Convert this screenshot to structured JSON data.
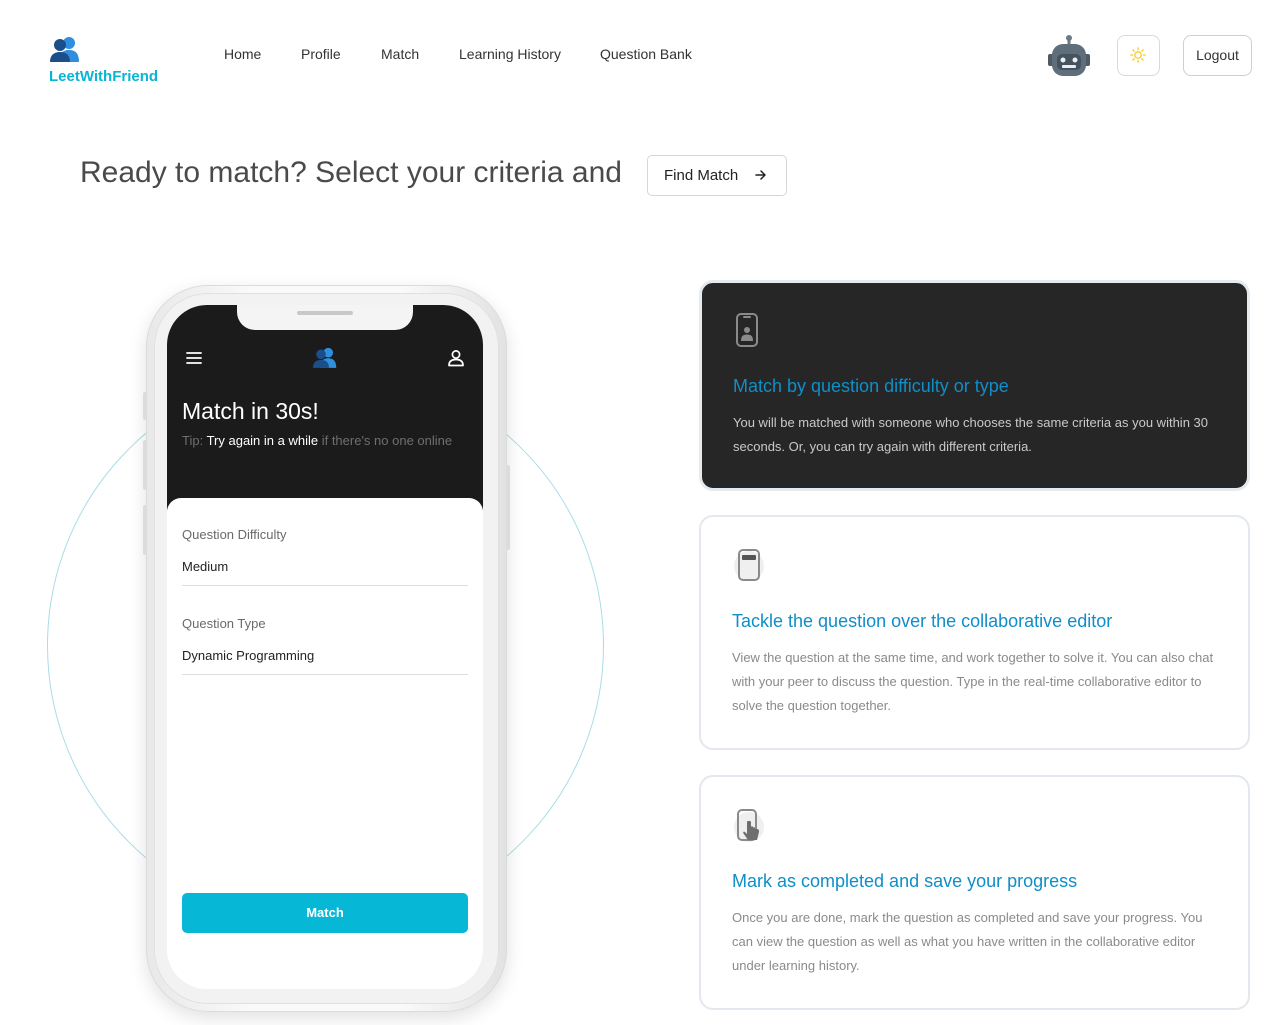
{
  "brand": {
    "name": "LeetWithFriend"
  },
  "nav": {
    "items": [
      "Home",
      "Profile",
      "Match",
      "Learning History",
      "Question Bank"
    ]
  },
  "header": {
    "logout_label": "Logout",
    "theme_icon": "sun-icon",
    "avatar_icon": "robot-avatar"
  },
  "hero": {
    "title": "Ready to match? Select your criteria and",
    "find_match_label": "Find Match"
  },
  "phone": {
    "title": "Match in 30s!",
    "tip_prefix": "Tip: ",
    "tip_highlight": "Try again in a while",
    "tip_suffix": " if there's no one online",
    "difficulty_label": "Question Difficulty",
    "difficulty_value": "Medium",
    "type_label": "Question Type",
    "type_value": "Dynamic Programming",
    "match_button": "Match"
  },
  "features": [
    {
      "title": "Match by question difficulty or type",
      "description": "You will be matched with someone who chooses the same criteria as you within 30 seconds. Or, you can try again with different criteria.",
      "icon": "phone-person-icon"
    },
    {
      "title": "Tackle the question over the collaborative editor",
      "description": "View the question at the same time, and work together to solve it. You can also chat with your peer to discuss the question. Type in the real-time collaborative editor to solve the question together.",
      "icon": "phone-editor-icon"
    },
    {
      "title": "Mark as completed and save your progress",
      "description": "Once you are done, mark the question as completed and save your progress. You can view the question as well as what you have written in the collaborative editor under learning history.",
      "icon": "phone-tap-icon"
    }
  ],
  "colors": {
    "accent": "#07b7d6",
    "brand": "#0ab4d4",
    "feature_title": "#0f8ec8",
    "dark_card": "#262626"
  }
}
